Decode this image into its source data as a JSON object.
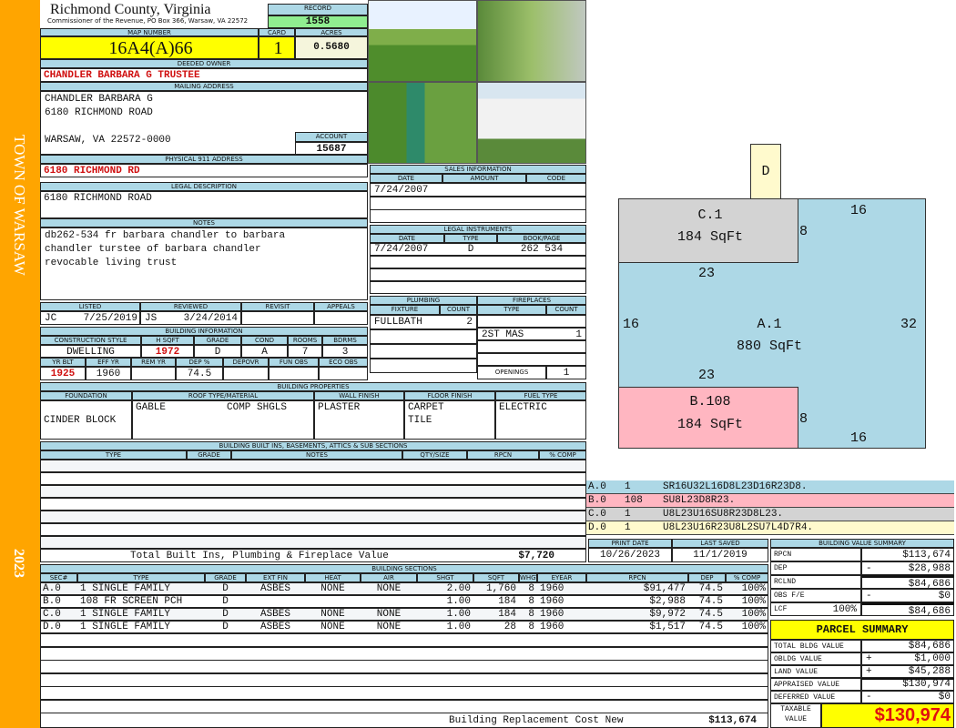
{
  "sidebar": {
    "town": "TOWN OF WARSAW",
    "year": "2023"
  },
  "header": {
    "county": "Richmond County, Virginia",
    "commissioner": "Commissioner of the Revenue, PO Box 366, Warsaw, VA 22572"
  },
  "record": {
    "label": "RECORD",
    "value": "1558"
  },
  "parcel": {
    "map_label": "MAP NUMBER",
    "card_label": "CARD",
    "acres_label": "ACRES",
    "map_number": "16A4(A)66",
    "card": "1",
    "acres": "0.5680"
  },
  "owner": {
    "label": "DEEDED OWNER",
    "name": "CHANDLER BARBARA G TRUSTEE"
  },
  "mailing": {
    "label": "MAILING ADDRESS",
    "line1": "CHANDLER BARBARA G",
    "line2": "6180 RICHMOND ROAD",
    "line3": "WARSAW, VA 22572-0000"
  },
  "account": {
    "label": "ACCOUNT",
    "value": "15687"
  },
  "physical": {
    "label": "PHYSICAL 911 ADDRESS",
    "value": "6180 RICHMOND RD"
  },
  "legal": {
    "label": "LEGAL DESCRIPTION",
    "value": "6180 RICHMOND ROAD"
  },
  "notes": {
    "label": "NOTES",
    "line1": "db262-534 fr barbara chandler to barbara",
    "line2": "chandler turstee of barbara chandler",
    "line3": "revocable living trust"
  },
  "sales": {
    "label": "SALES INFORMATION",
    "cols": [
      "DATE",
      "AMOUNT",
      "CODE"
    ],
    "date": "7/24/2007"
  },
  "instruments": {
    "label": "LEGAL INSTRUMENTS",
    "cols": [
      "DATE",
      "TYPE",
      "BOOK/PAGE"
    ],
    "date": "7/24/2007",
    "type": "D",
    "bookpage": "262 534"
  },
  "review": {
    "cols": [
      "LISTED",
      "REVIEWED",
      "REVISIT",
      "APPEALS"
    ],
    "listed_by": "JC",
    "listed_date": "7/25/2019",
    "reviewed_by": "JS",
    "reviewed_date": "3/24/2014"
  },
  "building_info": {
    "label": "BUILDING INFORMATION",
    "cols1": [
      "CONSTRUCTION STYLE",
      "H SQFT",
      "GRADE",
      "COND",
      "ROOMS",
      "BDRMS"
    ],
    "vals1": [
      "DWELLING",
      "1972",
      "D",
      "A",
      "7",
      "3"
    ],
    "cols2": [
      "YR BLT",
      "EFF YR",
      "REM YR",
      "DEP %",
      "DEPOVR",
      "FUN OBS",
      "ECO OBS"
    ],
    "vals2": [
      "1925",
      "1960",
      "",
      "74.5",
      "",
      "",
      ""
    ]
  },
  "plumbing": {
    "label": "PLUMBING",
    "cols": [
      "FIXTURE",
      "COUNT"
    ],
    "fixture": "FULLBATH",
    "count": "2"
  },
  "fireplaces": {
    "label": "FIREPLACES",
    "cols": [
      "TYPE",
      "COUNT"
    ],
    "type": "2ST MAS",
    "count": "1",
    "openings_label": "OPENINGS",
    "openings": "1"
  },
  "properties": {
    "label": "BUILDING PROPERTIES",
    "cols": [
      "FOUNDATION",
      "ROOF TYPE/MATERIAL",
      "WALL FINISH",
      "FLOOR FINISH",
      "FUEL TYPE"
    ],
    "foundation": "CINDER BLOCK",
    "roof_type": "GABLE",
    "roof_material": "COMP SHGLS",
    "wall": "PLASTER",
    "floor1": "CARPET",
    "floor2": "TILE",
    "fuel": "ELECTRIC"
  },
  "builtins": {
    "label": "BUILDING BUILT INS, BASEMENTS, ATTICS & SUB SECTIONS",
    "cols": [
      "TYPE",
      "GRADE",
      "NOTES",
      "QTY/SIZE",
      "RPCN",
      "% COMP"
    ],
    "total_label": "Total Built Ins, Plumbing & Fireplace Value",
    "total": "$7,720"
  },
  "dates": {
    "print_label": "PRINT DATE",
    "print": "10/26/2023",
    "saved_label": "LAST SAVED",
    "saved": "11/1/2019"
  },
  "sections": {
    "label": "BUILDING SECTIONS",
    "cols": [
      "SEC#",
      "TYPE",
      "GRADE",
      "EXT FIN",
      "HEAT",
      "AIR",
      "SHGT",
      "SQFT",
      "WHGT",
      "EYEAR",
      "RPCN",
      "DEP",
      "% COMP"
    ],
    "rows": [
      [
        "A.0",
        "1 SINGLE FAMILY",
        "D",
        "ASBES",
        "NONE",
        "NONE",
        "2.00",
        "1,760",
        "8",
        "1960",
        "$91,477",
        "74.5",
        "100%"
      ],
      [
        "B.0",
        "108 FR SCREEN PCH",
        "D",
        "",
        "",
        "",
        "1.00",
        "184",
        "8",
        "1960",
        "$2,988",
        "74.5",
        "100%"
      ],
      [
        "C.0",
        "1 SINGLE FAMILY",
        "D",
        "ASBES",
        "NONE",
        "NONE",
        "1.00",
        "184",
        "8",
        "1960",
        "$9,972",
        "74.5",
        "100%"
      ],
      [
        "D.0",
        "1 SINGLE FAMILY",
        "D",
        "ASBES",
        "NONE",
        "NONE",
        "1.00",
        "28",
        "8",
        "1960",
        "$1,517",
        "74.5",
        "100%"
      ]
    ],
    "replacement_label": "Building Replacement Cost New",
    "replacement": "$113,674"
  },
  "value_summary": {
    "label": "BUILDING VALUE SUMMARY",
    "rows": [
      {
        "label": "RPCN",
        "sign": "",
        "value": "$113,674",
        "pct": ""
      },
      {
        "label": "DEP",
        "sign": "-",
        "value": "$28,988",
        "pct": ""
      },
      {
        "label": "RCLND",
        "sign": "",
        "value": "$84,686",
        "pct": ""
      },
      {
        "label": "OBS F/E",
        "sign": "-",
        "value": "$0",
        "pct": ""
      },
      {
        "label": "LCF",
        "sign": "",
        "value": "$84,686",
        "pct": "100%"
      }
    ]
  },
  "parcel_summary": {
    "label": "PARCEL SUMMARY",
    "rows": [
      {
        "label": "TOTAL BLDG VALUE",
        "sign": "",
        "value": "$84,686"
      },
      {
        "label": "OBLDG VALUE",
        "sign": "+",
        "value": "$1,000"
      },
      {
        "label": "LAND VALUE",
        "sign": "+",
        "value": "$45,288"
      },
      {
        "label": "APPRAISED VALUE",
        "sign": "",
        "value": "$130,974"
      },
      {
        "label": "DEFERRED VALUE",
        "sign": "-",
        "value": "$0"
      }
    ],
    "taxable_label1": "TAXABLE",
    "taxable_label2": "VALUE",
    "taxable": "$130,974"
  },
  "sketch": {
    "labels": {
      "d": "D",
      "c_name": "C.1",
      "c_area": "184 SqFt",
      "a_name": "A.1",
      "a_area": "880 SqFt",
      "b_name": "B.108",
      "b_area": "184 SqFt",
      "dims": [
        "8",
        "16",
        "23",
        "16",
        "32",
        "23",
        "8",
        "16"
      ]
    },
    "legend": [
      {
        "sec": "A.0",
        "code": "1",
        "path": "SR16U32L16D8L23D16R23D8.",
        "color": "#add8e6"
      },
      {
        "sec": "B.0",
        "code": "108",
        "path": "SU8L23D8R23.",
        "color": "#ffb6c1"
      },
      {
        "sec": "C.0",
        "code": "1",
        "path": "U8L23U16SU8R23D8L23.",
        "color": "#d3d3d3"
      },
      {
        "sec": "D.0",
        "code": "1",
        "path": "U8L23U16R23U8L2SU7L4D7R4.",
        "color": "#fffacd"
      }
    ]
  }
}
